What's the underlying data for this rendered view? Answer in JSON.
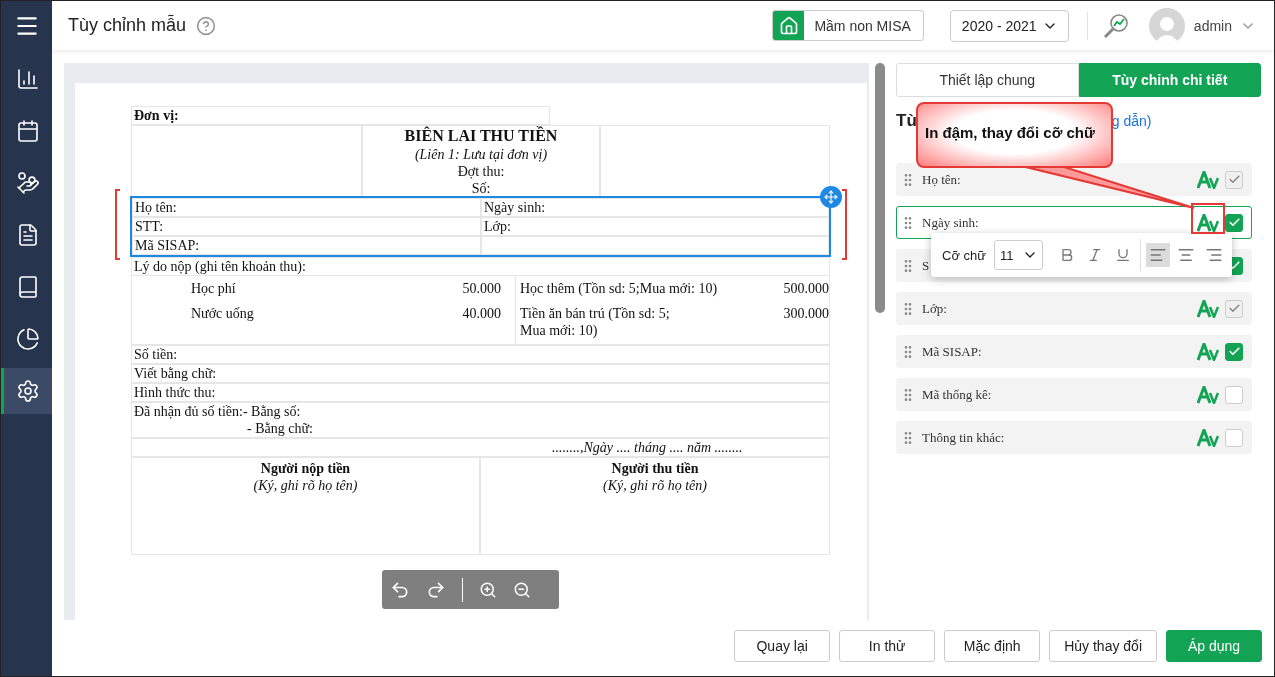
{
  "header": {
    "title": "Tùy chỉnh mẫu",
    "school": "Mầm non MISA",
    "year": "2020 - 2021",
    "user": "admin"
  },
  "sidebar": {
    "items": [
      {
        "kind": "chart",
        "selected": false
      },
      {
        "kind": "calendar",
        "selected": false
      },
      {
        "kind": "hand",
        "selected": false
      },
      {
        "kind": "document",
        "selected": false
      },
      {
        "kind": "book",
        "selected": false
      },
      {
        "kind": "pie",
        "selected": false
      },
      {
        "kind": "settings",
        "selected": true
      }
    ]
  },
  "receipt": {
    "unit_label": "Đơn vị:",
    "title": "BIÊN LAI THU TIỀN",
    "subtitle": "(Liên 1: Lưu tại đơn vị)",
    "header_lines": [
      "Đợt thu:",
      "Số:"
    ],
    "student_block": {
      "selected": true,
      "rows": [
        {
          "left": "Họ tên:",
          "right": "Ngày sinh:"
        },
        {
          "left": "STT:",
          "right": "Lớp:"
        },
        {
          "left": "Mã SISAP:"
        }
      ]
    },
    "reason_label": "Lý do nộp (ghi tên khoản thu):",
    "fees_left": [
      {
        "name_lines": [
          "Học phí"
        ],
        "amount": "50.000"
      },
      {
        "name_lines": [
          "Nước uống"
        ],
        "amount": "40.000"
      }
    ],
    "fees_right": [
      {
        "name_lines": [
          "Học thêm (Tồn sd: 5;Mua mới: 10)"
        ],
        "amount": "500.000"
      },
      {
        "name_lines": [
          "Tiền ăn bán trú (Tồn sd: 5;",
          "Mua mới: 10)"
        ],
        "amount": "300.000"
      }
    ],
    "info_lines": [
      "Số tiền:",
      "Viết bằng chữ:",
      "Hình thức thu:"
    ],
    "received": {
      "label": "Đã nhận đủ số tiền:",
      "by_number": "- Bằng số:",
      "by_words": "- Bằng chữ:"
    },
    "date_line": "........,Ngày .... tháng .... năm ........",
    "signers": [
      {
        "title": "Người nộp tiền",
        "note": "(Ký, ghi rõ họ tên)"
      },
      {
        "title": "Người thu tiền",
        "note": "(Ký, ghi rõ họ tên)"
      }
    ]
  },
  "panel": {
    "tabs": [
      {
        "label": "Thiết lập chung",
        "selected": false
      },
      {
        "label": "Tùy chỉnh chi tiết",
        "selected": true
      }
    ],
    "heading_start": "Tù",
    "guide_link_end": "g dẫn)",
    "fields": [
      {
        "label": "Họ tên:",
        "checked": true,
        "disabled": true,
        "selected": false
      },
      {
        "label": "Ngày sinh:",
        "checked": true,
        "disabled": false,
        "selected": true
      },
      {
        "label": "S",
        "checked": true,
        "disabled": false,
        "selected": false
      },
      {
        "label": "Lớp:",
        "checked": true,
        "disabled": true,
        "selected": false
      },
      {
        "label": "Mã SISAP:",
        "checked": true,
        "disabled": false,
        "selected": false
      },
      {
        "label": "Mã thống kê:",
        "checked": false,
        "disabled": false,
        "selected": false
      },
      {
        "label": "Thông tin khác:",
        "checked": false,
        "disabled": false,
        "selected": false
      }
    ]
  },
  "format_popover": {
    "size_label": "Cỡ chữ",
    "size": "11",
    "align": [
      {
        "kind": "left",
        "selected": true
      },
      {
        "kind": "center",
        "selected": false
      },
      {
        "kind": "right",
        "selected": false
      }
    ]
  },
  "callout": {
    "text": "In đậm, thay đổi cỡ chữ"
  },
  "buttons": [
    {
      "label": "Quay lại",
      "primary": false
    },
    {
      "label": "In thử",
      "primary": false
    },
    {
      "label": "Mặc định",
      "primary": false
    },
    {
      "label": "Hủy thay đổi",
      "primary": false
    },
    {
      "label": "Áp dụng",
      "primary": true
    }
  ]
}
